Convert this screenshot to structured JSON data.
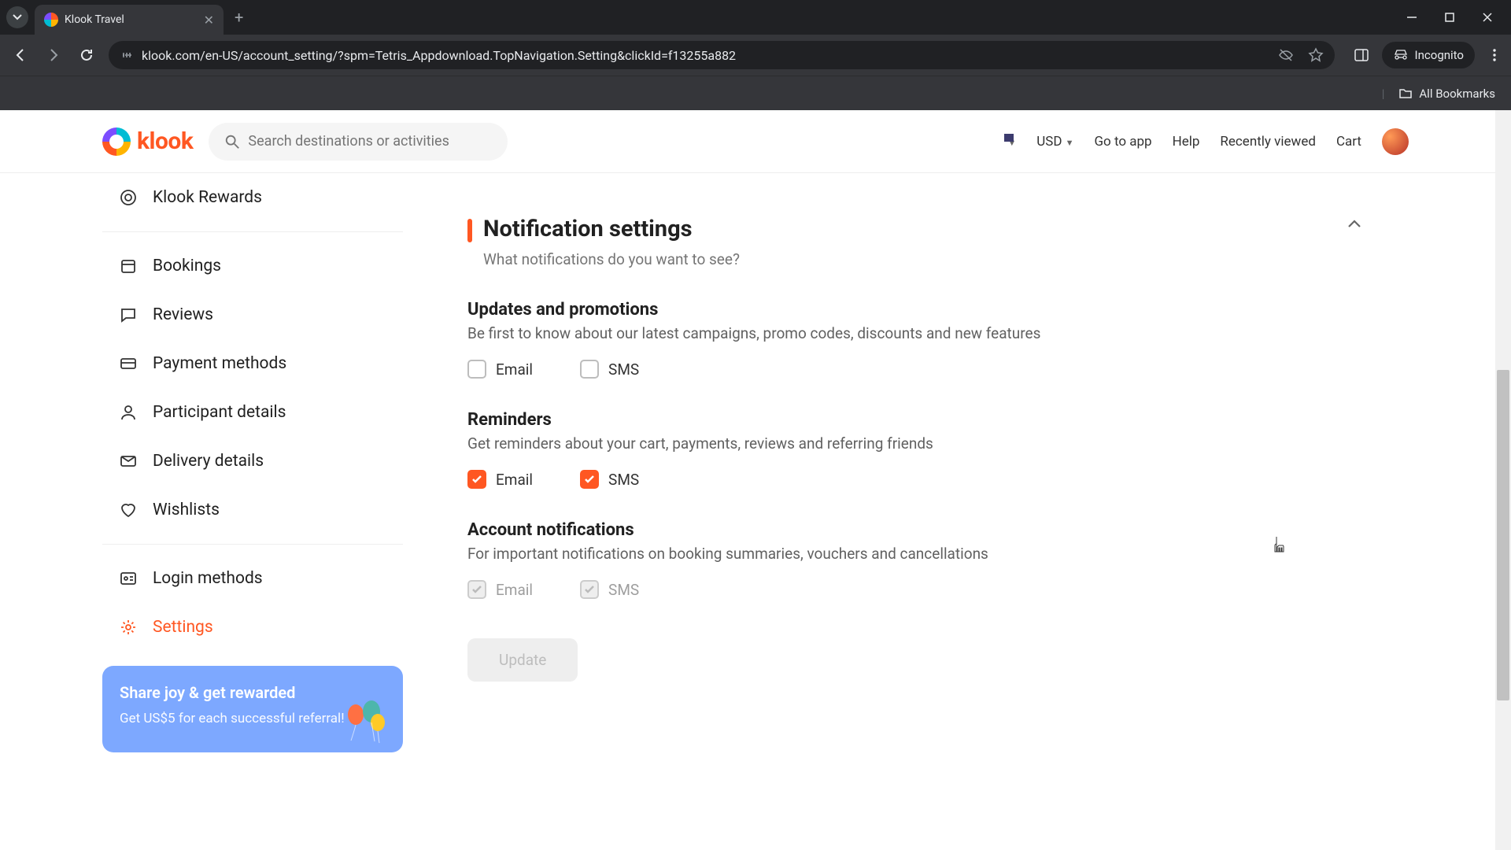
{
  "browser": {
    "tab_title": "Klook Travel",
    "url": "klook.com/en-US/account_setting/?spm=Tetris_Appdownload.TopNavigation.Setting&clickId=f13255a882",
    "incognito_label": "Incognito",
    "all_bookmarks_label": "All Bookmarks"
  },
  "header": {
    "logo_text": "klook",
    "search_placeholder": "Search destinations or activities",
    "currency": "USD",
    "links": {
      "go_to_app": "Go to app",
      "help": "Help",
      "recently_viewed": "Recently viewed",
      "cart": "Cart"
    }
  },
  "sidebar": {
    "items": [
      {
        "label": "Klook Rewards",
        "icon": "rewards"
      },
      {
        "label": "Bookings",
        "icon": "bookings"
      },
      {
        "label": "Reviews",
        "icon": "reviews"
      },
      {
        "label": "Payment methods",
        "icon": "payment"
      },
      {
        "label": "Participant details",
        "icon": "participant"
      },
      {
        "label": "Delivery details",
        "icon": "delivery"
      },
      {
        "label": "Wishlists",
        "icon": "wishlist"
      },
      {
        "label": "Login methods",
        "icon": "login"
      },
      {
        "label": "Settings",
        "icon": "settings"
      }
    ],
    "promo": {
      "title": "Share joy & get rewarded",
      "subtitle": "Get US$5 for each successful referral!"
    }
  },
  "main": {
    "section_title": "Notification settings",
    "section_sub": "What notifications do you want to see?",
    "groups": [
      {
        "title": "Updates and promotions",
        "desc": "Be first to know about our latest campaigns, promo codes, discounts and new features",
        "email_label": "Email",
        "sms_label": "SMS",
        "email_checked": false,
        "sms_checked": false,
        "locked": false
      },
      {
        "title": "Reminders",
        "desc": "Get reminders about your cart, payments, reviews and referring friends",
        "email_label": "Email",
        "sms_label": "SMS",
        "email_checked": true,
        "sms_checked": true,
        "locked": false
      },
      {
        "title": "Account notifications",
        "desc": "For important notifications on booking summaries, vouchers and cancellations",
        "email_label": "Email",
        "sms_label": "SMS",
        "email_checked": true,
        "sms_checked": true,
        "locked": true
      }
    ],
    "update_button": "Update"
  }
}
